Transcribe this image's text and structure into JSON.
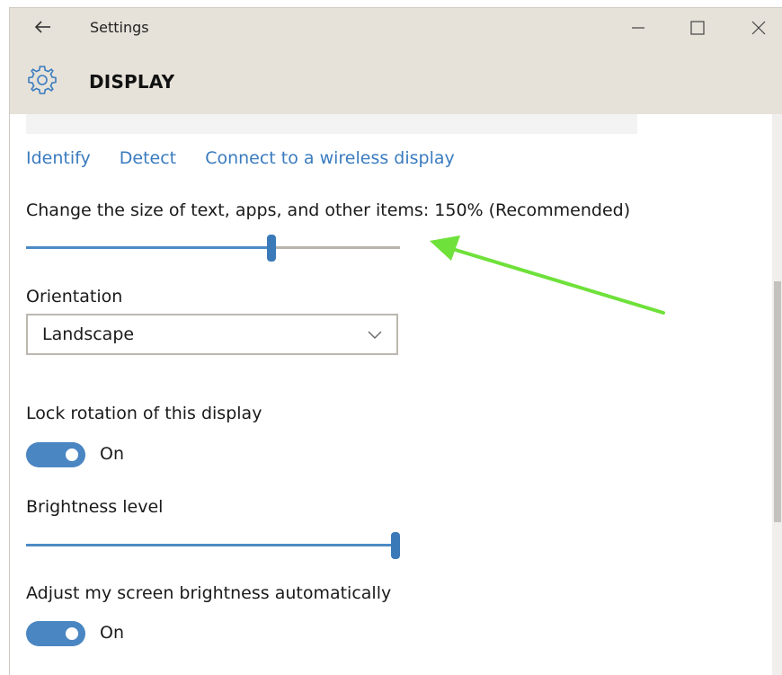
{
  "window": {
    "title": "Settings"
  },
  "header": {
    "title": "DISPLAY"
  },
  "links": {
    "identify": "Identify",
    "detect": "Detect",
    "wireless": "Connect to a wireless display"
  },
  "scale": {
    "label": "Change the size of text, apps, and other items: 150% (Recommended)",
    "level": 0.66
  },
  "orientation": {
    "label": "Orientation",
    "value": "Landscape"
  },
  "lock_rotation": {
    "label": "Lock rotation of this display",
    "state": "On"
  },
  "brightness": {
    "label": "Brightness level",
    "level": 1.0
  },
  "auto_brightness": {
    "label": "Adjust my screen brightness automatically",
    "state": "On"
  },
  "colors": {
    "accent": "#3b7ab9",
    "annotation_arrow": "#6ee13a",
    "chrome": "#e6e2d9"
  },
  "icons": {
    "back": "back-arrow-icon",
    "settings": "gear-icon",
    "minimize": "minimize-icon",
    "maximize": "maximize-icon",
    "close": "close-icon",
    "dropdown": "chevron-down-icon"
  }
}
